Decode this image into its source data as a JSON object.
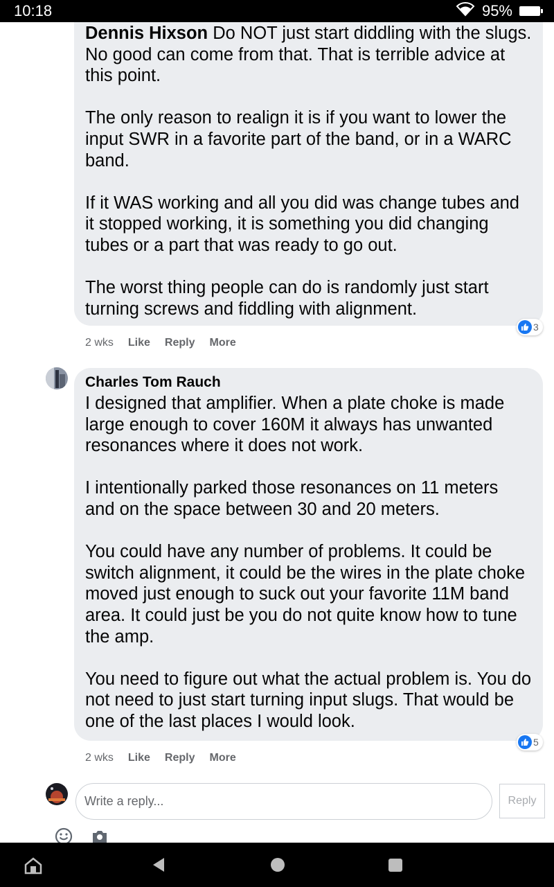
{
  "status_bar": {
    "time": "10:18",
    "battery": "95%"
  },
  "comments": [
    {
      "author": "Dennis Hixson",
      "paragraphs": [
        "Do NOT just start diddling with the slugs. No good can come from that. That is terrible advice at this point.",
        "The only reason to realign it is if you want to lower the input SWR in a favorite part of the band, or in a WARC band.",
        "If it WAS working and all you did was change tubes and it stopped working, it is something you did changing tubes or a part that was ready to go out.",
        "The worst thing people can do is randomly just start turning screws and fiddling with alignment."
      ],
      "reactions": "3",
      "time": "2 wks",
      "actions": [
        "Like",
        "Reply",
        "More"
      ]
    },
    {
      "author": "Charles Tom Rauch",
      "paragraphs": [
        "I designed that amplifier. When a plate choke is made large enough to cover 160M it always has unwanted resonances where it does not work.",
        "I intentionally parked those resonances on 11 meters and on the space between 30 and 20 meters.",
        "You could have any number of problems. It could be switch alignment, it could be the wires in the plate choke moved just enough to suck out your favorite 11M band area. It could just be you do not quite know how to tune the amp.",
        "You need to figure out what the actual problem is. You do not need to just start turning input slugs. That would be one of the last places I would look."
      ],
      "reactions": "5",
      "time": "2 wks",
      "actions": [
        "Like",
        "Reply",
        "More"
      ]
    }
  ],
  "reply_box": {
    "placeholder": "Write a reply...",
    "button_label": "Reply"
  },
  "icons": {
    "status": [
      "wifi-icon",
      "battery-icon"
    ],
    "reaction": "like-icon",
    "composer": [
      "emoji-icon",
      "camera-icon"
    ],
    "nav": [
      "accessibility-icon",
      "back-icon",
      "home-icon",
      "recents-icon"
    ]
  },
  "colors": {
    "bubble": "#ebedf0",
    "like_blue": "#1877f2",
    "secondary_text": "#65676b"
  }
}
